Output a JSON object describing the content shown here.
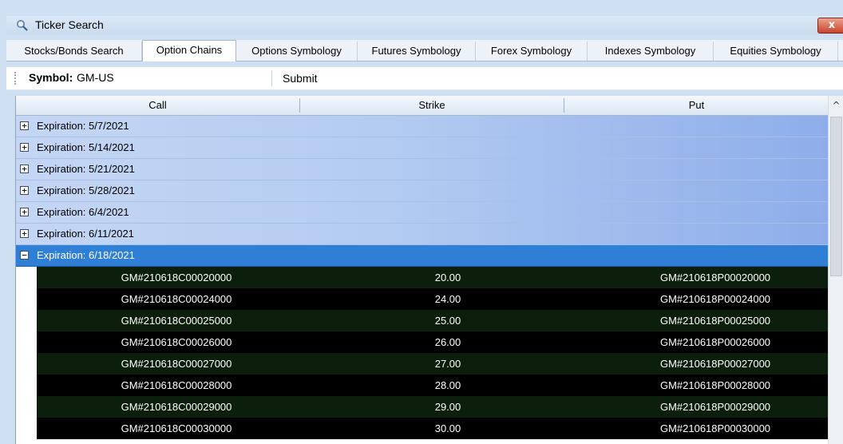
{
  "window": {
    "title": "Ticker Search",
    "close_label": "x"
  },
  "tabs": [
    {
      "label": "Stocks/Bonds Search"
    },
    {
      "label": "Option Chains",
      "active": true
    },
    {
      "label": "Options Symbology"
    },
    {
      "label": "Futures Symbology"
    },
    {
      "label": "Forex Symbology"
    },
    {
      "label": "Indexes Symbology"
    },
    {
      "label": "Equities Symbology"
    }
  ],
  "toolbar": {
    "symbol_label": "Symbol:",
    "symbol_value": "GM-US",
    "submit_label": "Submit"
  },
  "grid": {
    "columns": [
      "Call",
      "Strike",
      "Put"
    ],
    "groups": [
      {
        "label": "Expiration:  5/7/2021",
        "expanded": false
      },
      {
        "label": "Expiration:  5/14/2021",
        "expanded": false
      },
      {
        "label": "Expiration:  5/21/2021",
        "expanded": false
      },
      {
        "label": "Expiration:  5/28/2021",
        "expanded": false
      },
      {
        "label": "Expiration:  6/4/2021",
        "expanded": false
      },
      {
        "label": "Expiration:  6/11/2021",
        "expanded": false
      },
      {
        "label": "Expiration:  6/18/2021",
        "expanded": true
      }
    ],
    "rows": [
      {
        "call": "GM#210618C00020000",
        "strike": "20.00",
        "put": "GM#210618P00020000"
      },
      {
        "call": "GM#210618C00024000",
        "strike": "24.00",
        "put": "GM#210618P00024000"
      },
      {
        "call": "GM#210618C00025000",
        "strike": "25.00",
        "put": "GM#210618P00025000"
      },
      {
        "call": "GM#210618C00026000",
        "strike": "26.00",
        "put": "GM#210618P00026000"
      },
      {
        "call": "GM#210618C00027000",
        "strike": "27.00",
        "put": "GM#210618P00027000"
      },
      {
        "call": "GM#210618C00028000",
        "strike": "28.00",
        "put": "GM#210618P00028000"
      },
      {
        "call": "GM#210618C00029000",
        "strike": "29.00",
        "put": "GM#210618P00029000"
      },
      {
        "call": "GM#210618C00030000",
        "strike": "30.00",
        "put": "GM#210618P00030000"
      }
    ]
  },
  "icons": {
    "window": "search-icon",
    "expand": "plus-icon",
    "collapse": "minus-icon",
    "scroll_up": "chevron-up-icon"
  }
}
